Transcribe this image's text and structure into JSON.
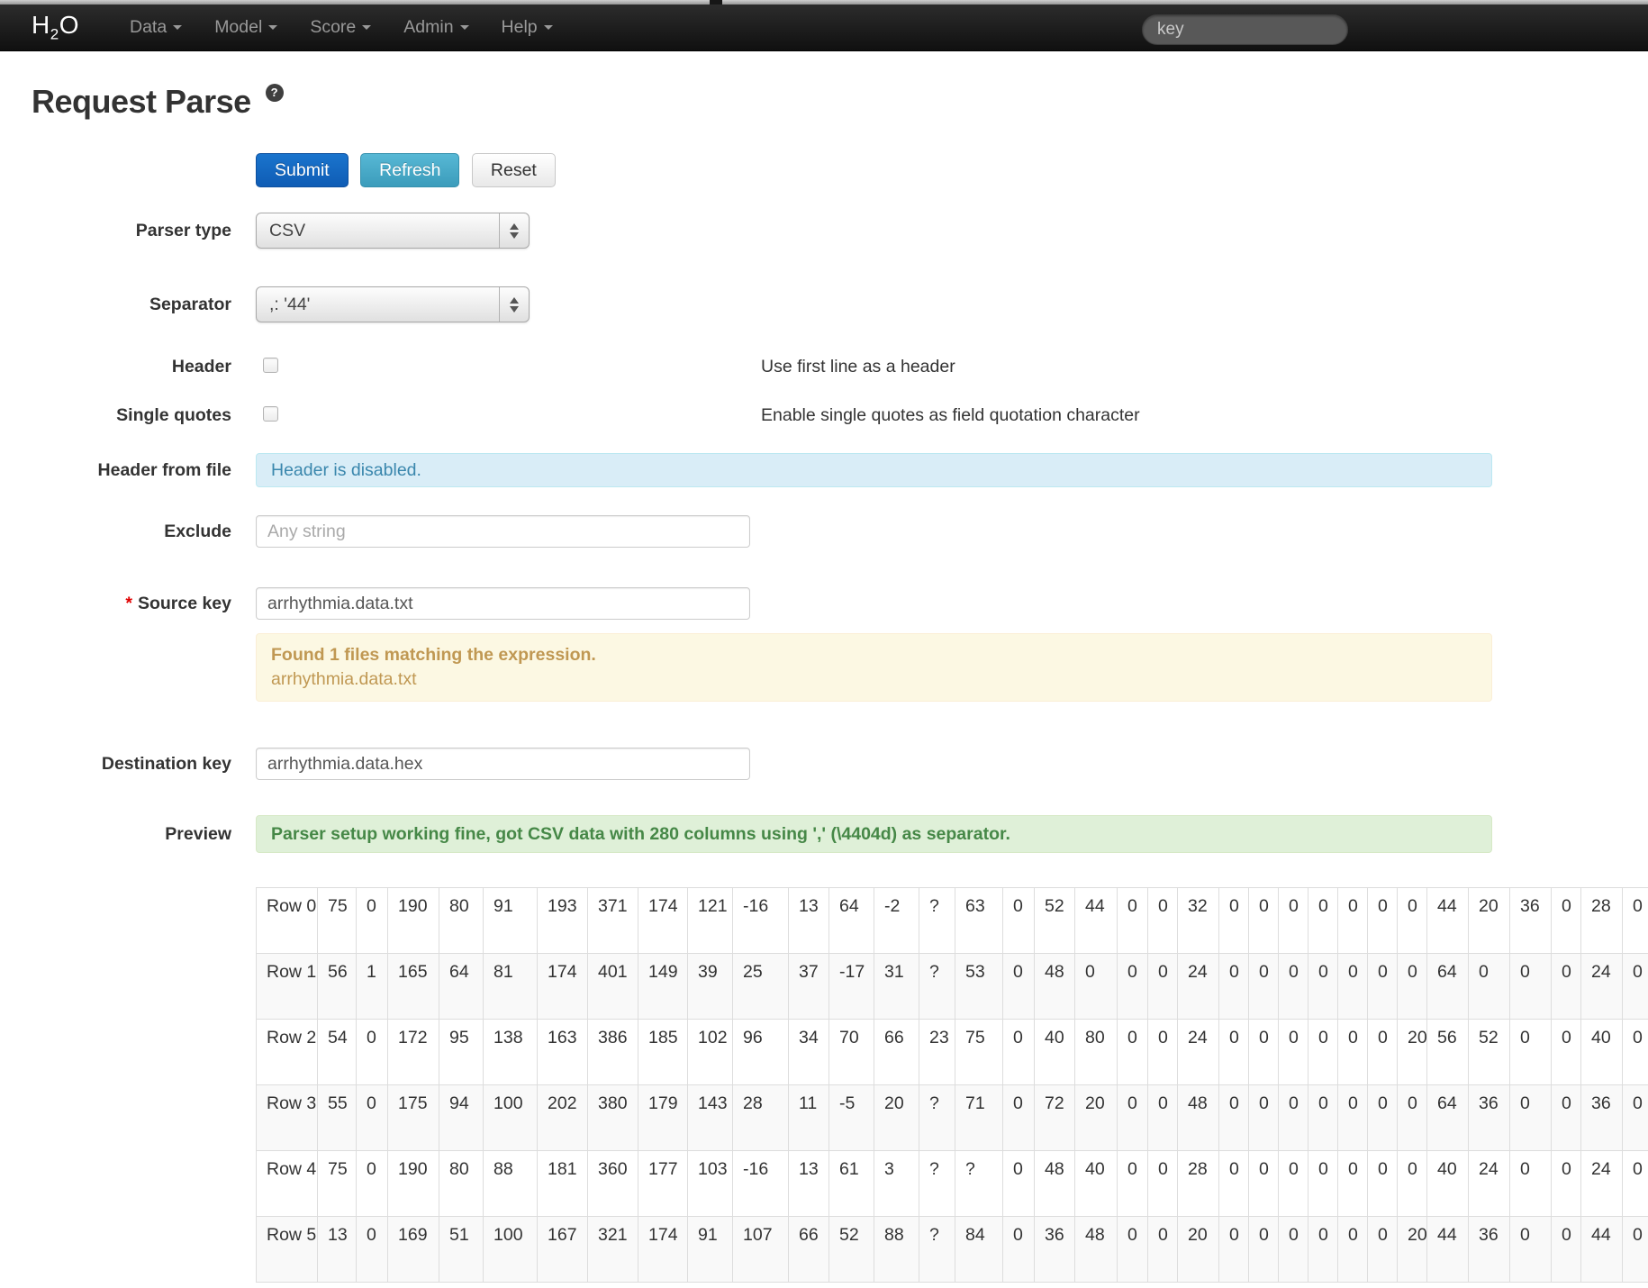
{
  "navbar": {
    "brand": {
      "h": "H",
      "sub": "2",
      "o": "O"
    },
    "menus": [
      "Data",
      "Model",
      "Score",
      "Admin",
      "Help"
    ],
    "search": {
      "placeholder": "key"
    }
  },
  "page": {
    "title": "Request Parse",
    "help": "?"
  },
  "toolbar": {
    "submit": "Submit",
    "refresh": "Refresh",
    "reset": "Reset"
  },
  "form": {
    "parser_type": {
      "label": "Parser type",
      "value": "CSV"
    },
    "separator": {
      "label": "Separator",
      "value": ",: '44'"
    },
    "header": {
      "label": "Header",
      "checked": false,
      "description": "Use first line as a header"
    },
    "single_quotes": {
      "label": "Single quotes",
      "checked": false,
      "description": "Enable single quotes as field quotation character"
    },
    "header_from_file": {
      "label": "Header from file",
      "message": "Header is disabled."
    },
    "exclude": {
      "label": "Exclude",
      "value": "",
      "placeholder": "Any string"
    },
    "source_key": {
      "required_mark": "*",
      "label": "Source key",
      "value": "arrhythmia.data.txt",
      "match_title": "Found 1 files matching the expression.",
      "match_file": "arrhythmia.data.txt"
    },
    "destination_key": {
      "label": "Destination key",
      "value": "arrhythmia.data.hex"
    },
    "preview": {
      "label": "Preview",
      "message": "Parser setup working fine, got CSV data with 280 columns using ',' (\\4404d) as separator."
    }
  },
  "preview_table": {
    "rows": [
      {
        "label": "Row 0",
        "values": [
          "75",
          "0",
          "190",
          "80",
          "91",
          "193",
          "371",
          "174",
          "121",
          "-16",
          "13",
          "64",
          "-2",
          "?",
          "63",
          "0",
          "52",
          "44",
          "0",
          "0",
          "32",
          "0",
          "0",
          "0",
          "0",
          "0",
          "0",
          "0",
          "44",
          "20",
          "36",
          "0",
          "28",
          "0"
        ]
      },
      {
        "label": "Row 1",
        "values": [
          "56",
          "1",
          "165",
          "64",
          "81",
          "174",
          "401",
          "149",
          "39",
          "25",
          "37",
          "-17",
          "31",
          "?",
          "53",
          "0",
          "48",
          "0",
          "0",
          "0",
          "24",
          "0",
          "0",
          "0",
          "0",
          "0",
          "0",
          "0",
          "64",
          "0",
          "0",
          "0",
          "24",
          "0"
        ]
      },
      {
        "label": "Row 2",
        "values": [
          "54",
          "0",
          "172",
          "95",
          "138",
          "163",
          "386",
          "185",
          "102",
          "96",
          "34",
          "70",
          "66",
          "23",
          "75",
          "0",
          "40",
          "80",
          "0",
          "0",
          "24",
          "0",
          "0",
          "0",
          "0",
          "0",
          "0",
          "20",
          "56",
          "52",
          "0",
          "0",
          "40",
          "0"
        ]
      },
      {
        "label": "Row 3",
        "values": [
          "55",
          "0",
          "175",
          "94",
          "100",
          "202",
          "380",
          "179",
          "143",
          "28",
          "11",
          "-5",
          "20",
          "?",
          "71",
          "0",
          "72",
          "20",
          "0",
          "0",
          "48",
          "0",
          "0",
          "0",
          "0",
          "0",
          "0",
          "0",
          "64",
          "36",
          "0",
          "0",
          "36",
          "0"
        ]
      },
      {
        "label": "Row 4",
        "values": [
          "75",
          "0",
          "190",
          "80",
          "88",
          "181",
          "360",
          "177",
          "103",
          "-16",
          "13",
          "61",
          "3",
          "?",
          "?",
          "0",
          "48",
          "40",
          "0",
          "0",
          "28",
          "0",
          "0",
          "0",
          "0",
          "0",
          "0",
          "0",
          "40",
          "24",
          "0",
          "0",
          "24",
          "0"
        ]
      },
      {
        "label": "Row 5",
        "values": [
          "13",
          "0",
          "169",
          "51",
          "100",
          "167",
          "321",
          "174",
          "91",
          "107",
          "66",
          "52",
          "88",
          "?",
          "84",
          "0",
          "36",
          "48",
          "0",
          "0",
          "20",
          "0",
          "0",
          "0",
          "0",
          "0",
          "0",
          "20",
          "44",
          "36",
          "0",
          "0",
          "44",
          "0"
        ]
      }
    ]
  },
  "colors": {
    "navbar_bg": "#1b1b1b",
    "accent_primary": "#1266c8",
    "accent_info": "#49afcd",
    "alert_info_text": "#3a87ad",
    "alert_warning_text": "#c09853",
    "alert_success_text": "#468847"
  }
}
